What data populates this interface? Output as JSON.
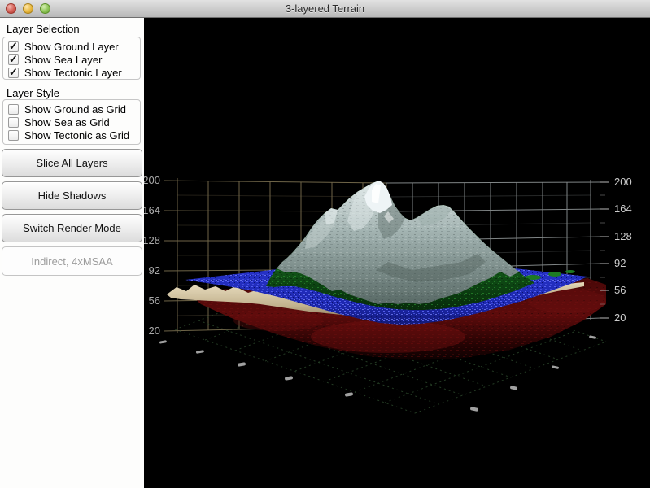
{
  "window": {
    "title": "3-layered Terrain",
    "traffic_lights": [
      "close",
      "minimize",
      "zoom"
    ]
  },
  "sidebar": {
    "checkmark_glyph": "✓",
    "layer_selection": {
      "title": "Layer Selection",
      "items": [
        {
          "label": "Show Ground Layer",
          "checked": true
        },
        {
          "label": "Show Sea Layer",
          "checked": true
        },
        {
          "label": "Show Tectonic Layer",
          "checked": true
        }
      ]
    },
    "layer_style": {
      "title": "Layer Style",
      "items": [
        {
          "label": "Show Ground as Grid",
          "checked": false
        },
        {
          "label": "Show Sea as Grid",
          "checked": false
        },
        {
          "label": "Show Tectonic as Grid",
          "checked": false
        }
      ]
    },
    "buttons": [
      {
        "label": "Slice All Layers"
      },
      {
        "label": "Hide Shadows"
      },
      {
        "label": "Switch Render Mode"
      }
    ],
    "status": "Indirect, 4xMSAA"
  },
  "scene": {
    "background": "#000000",
    "axis_left": {
      "labels": [
        "200",
        "164",
        "128",
        "92",
        "56",
        "20"
      ]
    },
    "axis_right": {
      "labels": [
        "200",
        "164",
        "128",
        "92",
        "56",
        "20"
      ]
    },
    "layers": [
      {
        "name": "Ground (mountain)",
        "color": "#8fa09e"
      },
      {
        "name": "Ground foothills",
        "color": "#1d7a22"
      },
      {
        "name": "Sea",
        "color": "#2433c8"
      },
      {
        "name": "Ground skirt",
        "color": "#d6c9a9"
      },
      {
        "name": "Tectonic",
        "color": "#5c0b0b"
      }
    ]
  }
}
